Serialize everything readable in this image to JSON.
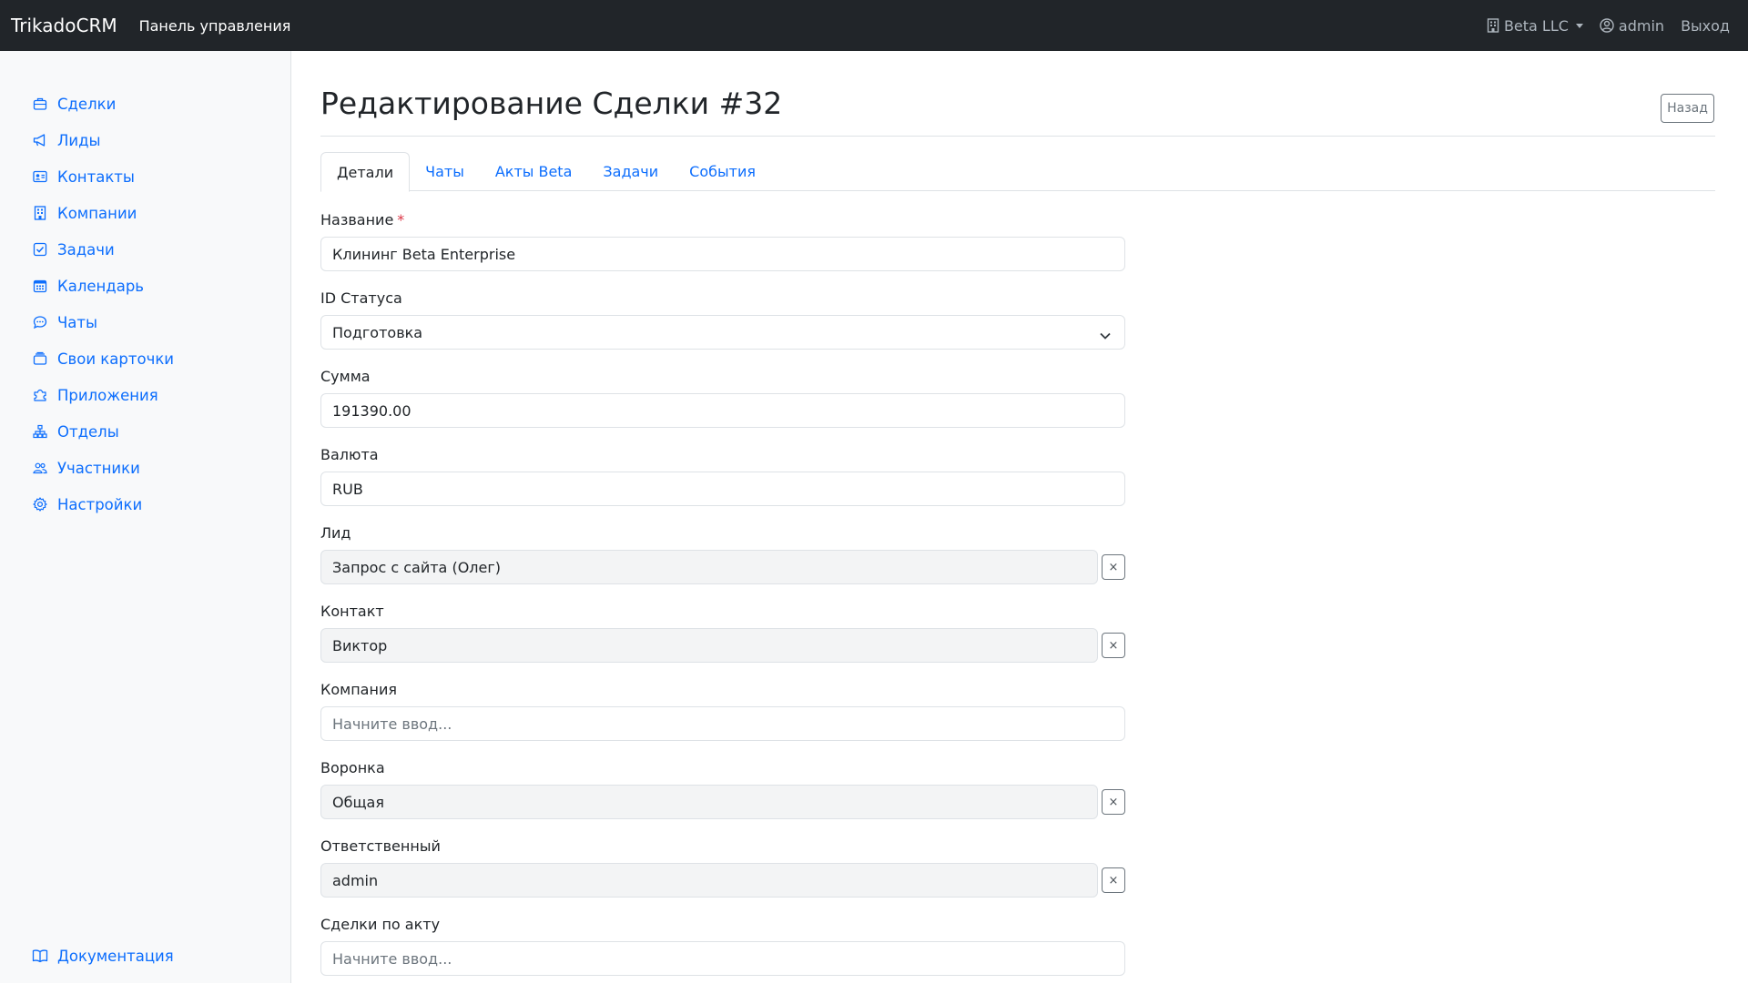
{
  "navbar": {
    "brand": "TrikadoCRM",
    "title": "Панель управления",
    "company": "Beta LLC",
    "user": "admin",
    "logout": "Выход"
  },
  "sidebar": {
    "items": [
      {
        "label": "Сделки",
        "icon": "briefcase-icon"
      },
      {
        "label": "Лиды",
        "icon": "megaphone-icon"
      },
      {
        "label": "Контакты",
        "icon": "person-card-icon"
      },
      {
        "label": "Компании",
        "icon": "building-icon"
      },
      {
        "label": "Задачи",
        "icon": "check-square-icon"
      },
      {
        "label": "Календарь",
        "icon": "calendar-icon"
      },
      {
        "label": "Чаты",
        "icon": "chat-icon"
      },
      {
        "label": "Свои карточки",
        "icon": "cards-icon"
      },
      {
        "label": "Приложения",
        "icon": "puzzle-icon"
      },
      {
        "label": "Отделы",
        "icon": "diagram-icon"
      },
      {
        "label": "Участники",
        "icon": "people-icon"
      },
      {
        "label": "Настройки",
        "icon": "gear-icon"
      }
    ],
    "docs": "Документация"
  },
  "page": {
    "title": "Редактирование Сделки #32",
    "back": "Назад"
  },
  "tabs": [
    "Детали",
    "Чаты",
    "Акты Beta",
    "Задачи",
    "События"
  ],
  "form": {
    "name": {
      "label": "Название",
      "required": "*",
      "value": "Клининг Beta Enterprise"
    },
    "status": {
      "label": "ID Статуса",
      "value": "Подготовка"
    },
    "amount": {
      "label": "Сумма",
      "value": "191390.00"
    },
    "currency": {
      "label": "Валюта",
      "value": "RUB"
    },
    "lead": {
      "label": "Лид",
      "value": "Запрос с сайта (Олег)",
      "clear": "×"
    },
    "contact": {
      "label": "Контакт",
      "value": "Виктор",
      "clear": "×"
    },
    "company": {
      "label": "Компания",
      "placeholder": "Начните ввод..."
    },
    "funnel": {
      "label": "Воронка",
      "value": "Общая",
      "clear": "×"
    },
    "responsible": {
      "label": "Ответственный",
      "value": "admin",
      "clear": "×"
    },
    "act_deals": {
      "label": "Сделки по акту",
      "placeholder": "Начните ввод..."
    }
  },
  "colors": {
    "navbar_bg": "#212529",
    "sidebar_bg": "#f8f9fa",
    "link": "#0d6efd",
    "required": "#dc3545"
  }
}
